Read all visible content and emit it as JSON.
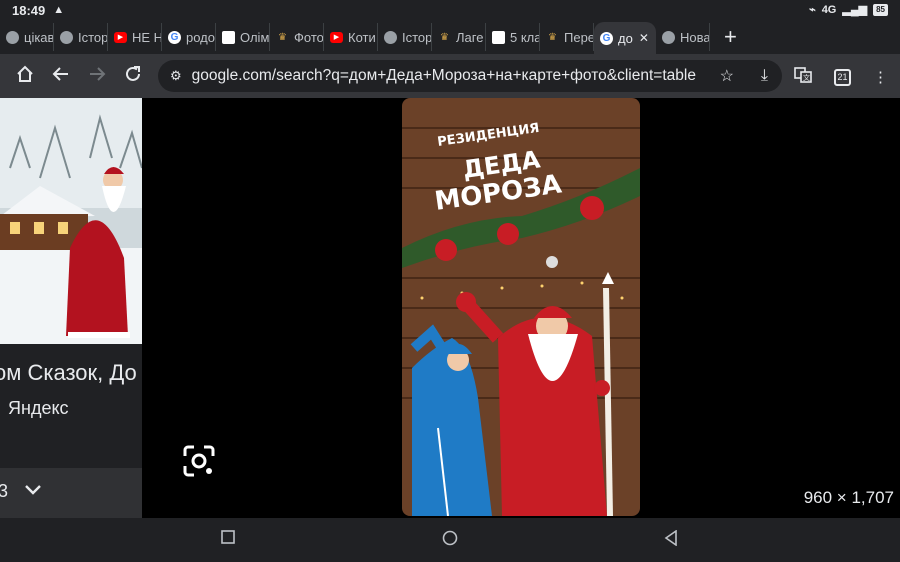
{
  "status": {
    "time": "18:49",
    "alert": "▲",
    "signal": "4G",
    "battery": "85"
  },
  "tabs": [
    {
      "label": "цікав",
      "fav": "chrome",
      "color": "#9aa0a6"
    },
    {
      "label": "Істор",
      "fav": "chrome",
      "color": "#9aa0a6"
    },
    {
      "label": "НЕ Н",
      "fav": "youtube",
      "color": "#ff0000"
    },
    {
      "label": "родо",
      "fav": "google",
      "color": "#ffffff"
    },
    {
      "label": "Олім",
      "fav": "site",
      "color": "#ffffff"
    },
    {
      "label": "Фото",
      "fav": "site2",
      "color": "#d4a54a"
    },
    {
      "label": "Коти",
      "fav": "youtube",
      "color": "#ff0000"
    },
    {
      "label": "Істор",
      "fav": "chrome",
      "color": "#9aa0a6"
    },
    {
      "label": "Лаге",
      "fav": "site2",
      "color": "#d4a54a"
    },
    {
      "label": "5 кла",
      "fav": "site3",
      "color": "#ffffff"
    },
    {
      "label": "Пере",
      "fav": "site2",
      "color": "#d4a54a"
    },
    {
      "label": "до",
      "fav": "google",
      "color": "#ffffff",
      "active": true
    },
    {
      "label": "Нова",
      "fav": "chrome",
      "color": "#9aa0a6"
    }
  ],
  "toolbar": {
    "url": "google.com/search?q=дом+Деда+Мороза+на+карте+фото&client=table",
    "tab_count": "21"
  },
  "result": {
    "title": "ом Сказок, До",
    "source": "Яндекс",
    "page_num": "3"
  },
  "viewer": {
    "dimensions": "960 × 1,707",
    "sign_line1": "РЕЗИДЕНЦИЯ",
    "sign_line2": "ДЕДА",
    "sign_line3": "МОРОЗА"
  }
}
